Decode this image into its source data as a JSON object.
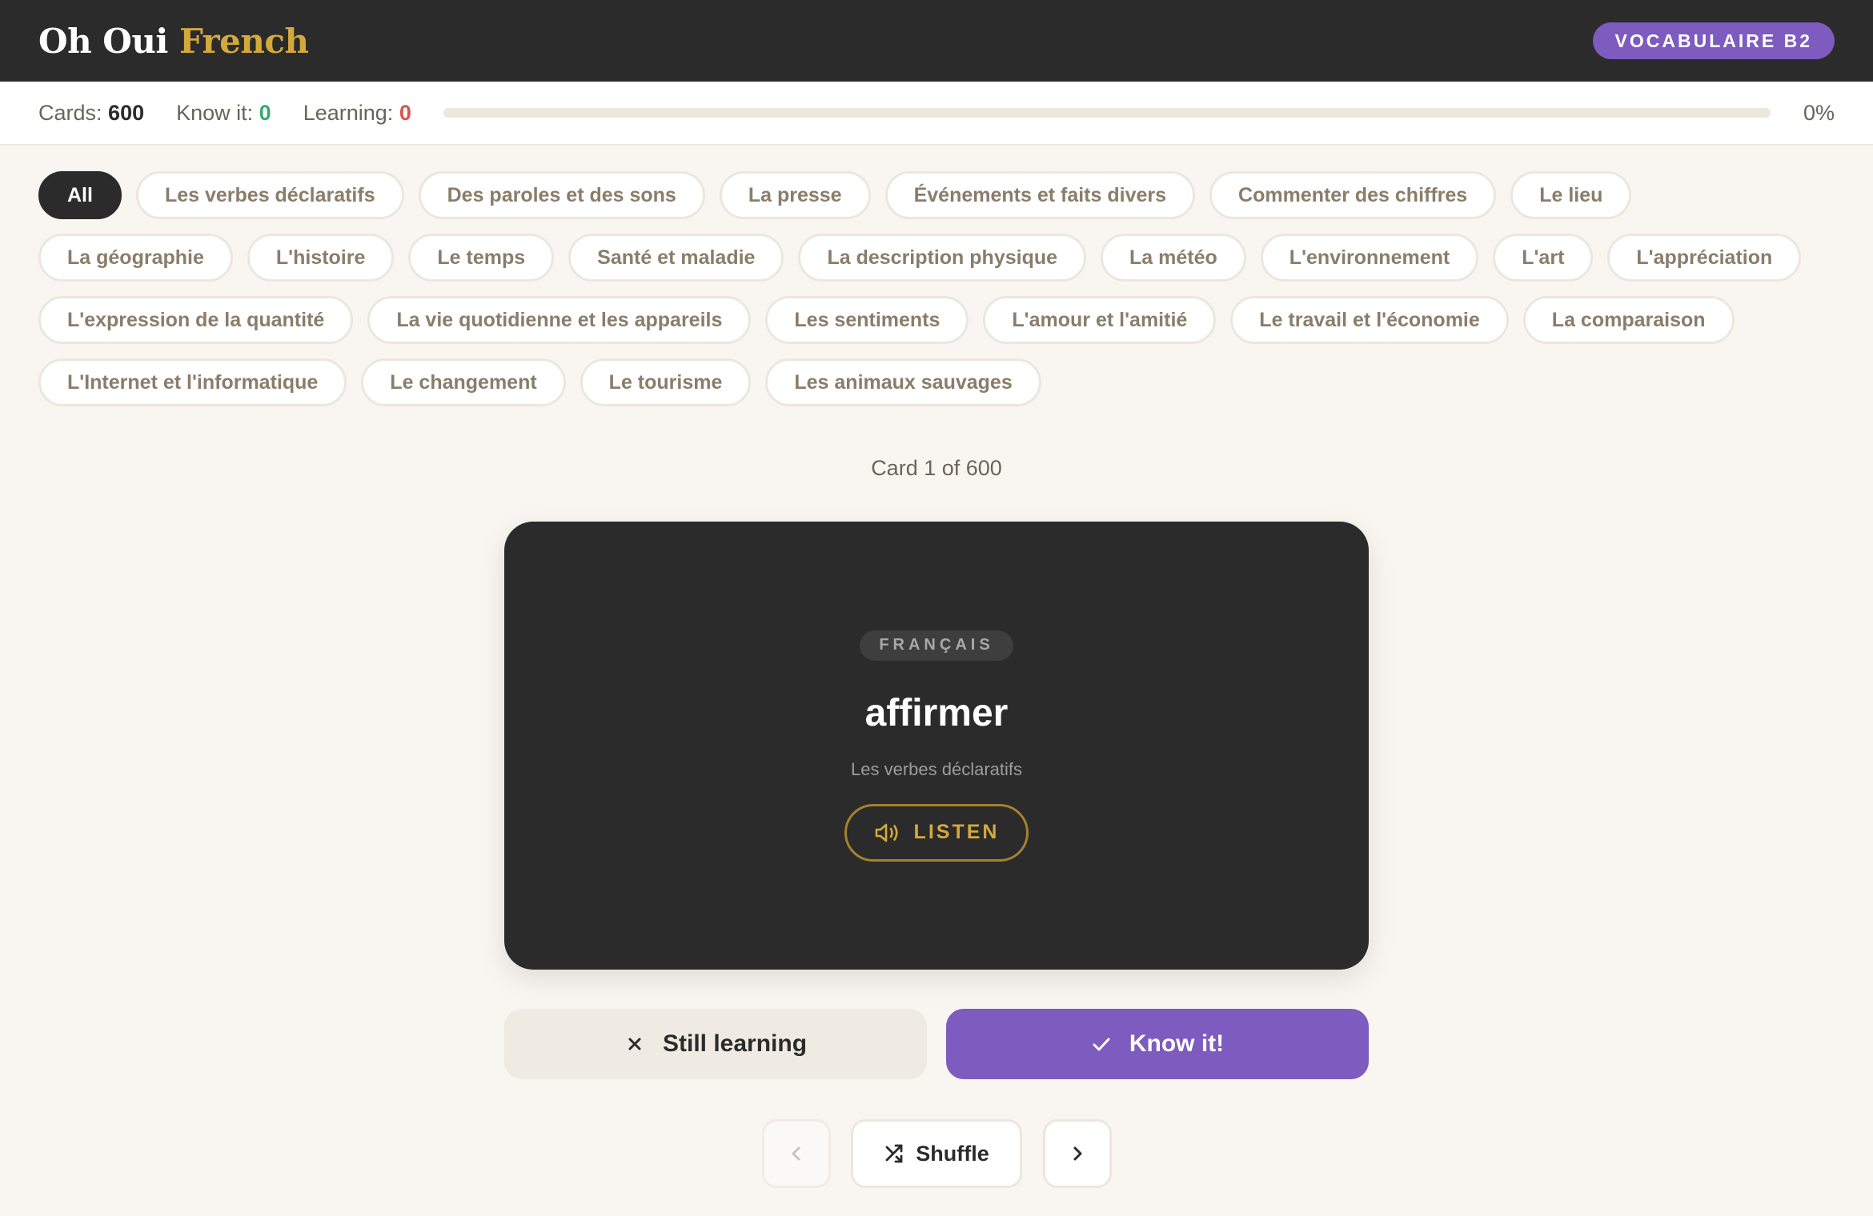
{
  "header": {
    "logo_main": "Oh Oui",
    "logo_accent": "French",
    "level_badge": "VOCABULAIRE B2"
  },
  "stats": {
    "cards_label": "Cards:",
    "cards_value": "600",
    "know_label": "Know it:",
    "know_value": "0",
    "learning_label": "Learning:",
    "learning_value": "0",
    "progress_percent": "0%",
    "progress_fraction": 0
  },
  "categories": [
    {
      "label": "All",
      "active": true
    },
    {
      "label": "Les verbes déclaratifs"
    },
    {
      "label": "Des paroles et des sons"
    },
    {
      "label": "La presse"
    },
    {
      "label": "Événements et faits divers"
    },
    {
      "label": "Commenter des chiffres"
    },
    {
      "label": "Le lieu"
    },
    {
      "label": "La géographie"
    },
    {
      "label": "L'histoire"
    },
    {
      "label": "Le temps"
    },
    {
      "label": "Santé et maladie"
    },
    {
      "label": "La description physique"
    },
    {
      "label": "La météo"
    },
    {
      "label": "L'environnement"
    },
    {
      "label": "L'art"
    },
    {
      "label": "L'appréciation"
    },
    {
      "label": "L'expression de la quantité"
    },
    {
      "label": "La vie quotidienne et les appareils"
    },
    {
      "label": "Les sentiments"
    },
    {
      "label": "L'amour et l'amitié"
    },
    {
      "label": "Le travail et l'économie"
    },
    {
      "label": "La comparaison"
    },
    {
      "label": "L'Internet et l'informatique"
    },
    {
      "label": "Le changement"
    },
    {
      "label": "Le tourisme"
    },
    {
      "label": "Les animaux sauvages"
    }
  ],
  "counter": "Card 1 of 600",
  "card": {
    "language": "FRANÇAIS",
    "word": "affirmer",
    "category": "Les verbes déclaratifs",
    "listen_label": "LISTEN"
  },
  "actions": {
    "still_learning": "Still learning",
    "know_it": "Know it!"
  },
  "nav": {
    "shuffle": "Shuffle"
  },
  "icons": {
    "speaker": "speaker-icon",
    "close": "close-icon",
    "check": "check-icon",
    "shuffle": "shuffle-icon",
    "prev": "chevron-left-icon",
    "next": "chevron-right-icon"
  },
  "colors": {
    "accent_purple": "#7e5bbf",
    "accent_gold": "#d4a93c",
    "dark": "#2b2b2b",
    "know_green": "#3aa76d",
    "learning_red": "#d9534f"
  }
}
